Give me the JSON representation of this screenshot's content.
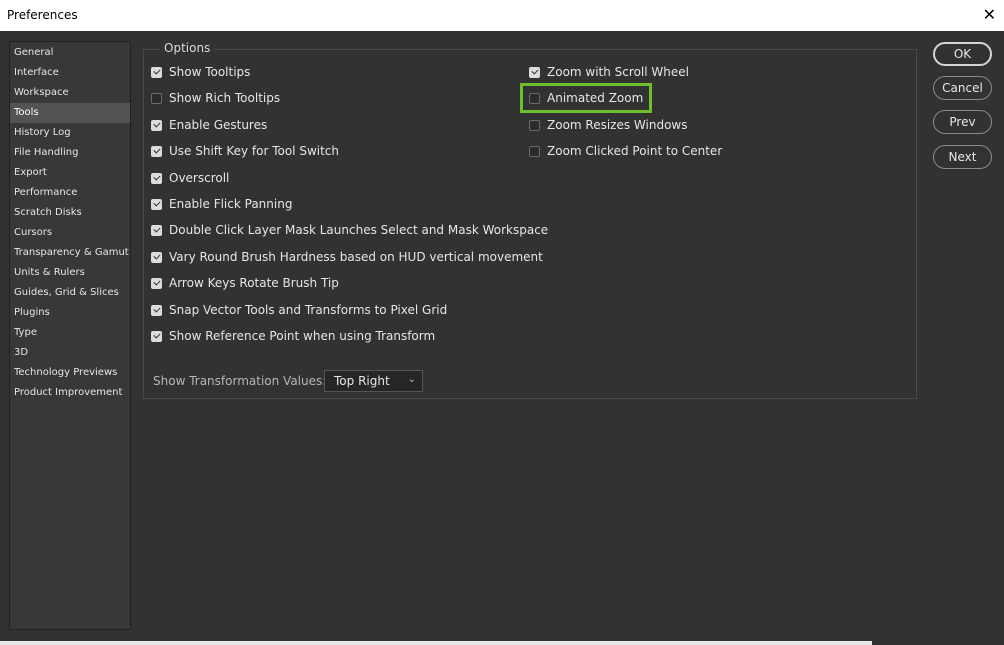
{
  "window": {
    "title": "Preferences",
    "close_glyph": "✕"
  },
  "sidebar": {
    "items": [
      {
        "label": "General"
      },
      {
        "label": "Interface"
      },
      {
        "label": "Workspace"
      },
      {
        "label": "Tools"
      },
      {
        "label": "History Log"
      },
      {
        "label": "File Handling"
      },
      {
        "label": "Export"
      },
      {
        "label": "Performance"
      },
      {
        "label": "Scratch Disks"
      },
      {
        "label": "Cursors"
      },
      {
        "label": "Transparency & Gamut"
      },
      {
        "label": "Units & Rulers"
      },
      {
        "label": "Guides, Grid & Slices"
      },
      {
        "label": "Plugins"
      },
      {
        "label": "Type"
      },
      {
        "label": "3D"
      },
      {
        "label": "Technology Previews"
      },
      {
        "label": "Product Improvement"
      }
    ],
    "active_index": 3
  },
  "options": {
    "legend": "Options",
    "left": [
      {
        "label": "Show Tooltips",
        "checked": true
      },
      {
        "label": "Show Rich Tooltips",
        "checked": false
      },
      {
        "label": "Enable Gestures",
        "checked": true
      },
      {
        "label": "Use Shift Key for Tool Switch",
        "checked": true
      },
      {
        "label": "Overscroll",
        "checked": true
      },
      {
        "label": "Enable Flick Panning",
        "checked": true
      },
      {
        "label": "Double Click Layer Mask Launches Select and Mask Workspace",
        "checked": true
      },
      {
        "label": "Vary Round Brush Hardness based on HUD vertical movement",
        "checked": true
      },
      {
        "label": "Arrow Keys Rotate Brush Tip",
        "checked": true
      },
      {
        "label": "Snap Vector Tools and Transforms to Pixel Grid",
        "checked": true
      },
      {
        "label": "Show Reference Point when using Transform",
        "checked": true
      }
    ],
    "right": [
      {
        "label": "Zoom with Scroll Wheel",
        "checked": true
      },
      {
        "label": "Animated Zoom",
        "checked": false
      },
      {
        "label": "Zoom Resizes Windows",
        "checked": false
      },
      {
        "label": "Zoom Clicked Point to Center",
        "checked": false
      }
    ],
    "transformation_values": {
      "label": "Show Transformation Values:",
      "selected": "Top Right"
    }
  },
  "buttons": {
    "ok": "OK",
    "cancel": "Cancel",
    "prev": "Prev",
    "next": "Next"
  },
  "colors": {
    "highlight": "#6cc02c",
    "background": "#323232",
    "active_item": "#535353"
  }
}
